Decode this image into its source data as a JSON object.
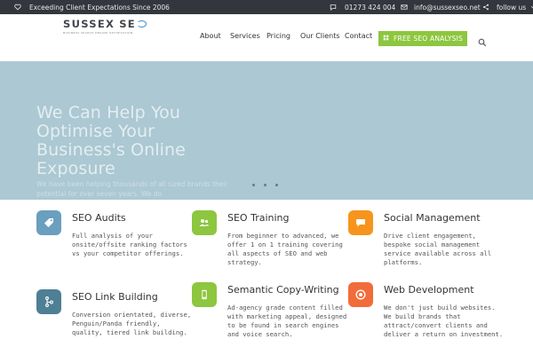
{
  "topbar": {
    "tagline": "Exceeding Client Expectations Since 2006",
    "phone": "01273 424 004",
    "email": "info@sussexseo.net",
    "follow": "follow us"
  },
  "logo": {
    "word1": "SUSSEX",
    "word2": "SE",
    "tagline": "BUSINESS SEARCH ENGINE OPTIMISATION"
  },
  "nav": {
    "items": [
      "About",
      "Services",
      "Pricing",
      "Our Clients",
      "Contact"
    ],
    "cta": "FREE SEO ANALYSIS"
  },
  "hero": {
    "title": "We Can Help You Optimise Your Business's Online Exposure",
    "subtitle": "We have been helping thousands of all sized brands their potential for over seven years. We do"
  },
  "services": [
    {
      "title": "SEO Audits",
      "desc": "Full analysis of your onsite/offsite ranking factors vs your competitor offerings.",
      "color": "#6b9fbf",
      "icon": "tag-icon"
    },
    {
      "title": "SEO Training",
      "desc": "From beginner to advanced, we offer 1 on 1 training covering all aspects of SEO and web strategy.",
      "color": "#8dc63f",
      "icon": "users-icon"
    },
    {
      "title": "Social Management",
      "desc": "Drive client engagement, bespoke social management service available across all platforms.",
      "color": "#f7941d",
      "icon": "chat-icon"
    },
    {
      "title": "SEO Link Building",
      "desc": "Conversion orientated, diverse, Penguin/Panda friendly, quality, tiered link building.",
      "color": "#4e7f95",
      "icon": "link-tree-icon"
    },
    {
      "title": "Semantic Copy-Writing",
      "desc": "Ad-agency grade content filled with marketing appeal, designed to be found in search engines and voice search.",
      "color": "#8dc63f",
      "icon": "mobile-icon"
    },
    {
      "title": "Web Development",
      "desc": "We don't just build websites. We build brands that attract/convert clients and deliver a return on investment.",
      "color": "#f26b3a",
      "icon": "target-icon"
    }
  ]
}
